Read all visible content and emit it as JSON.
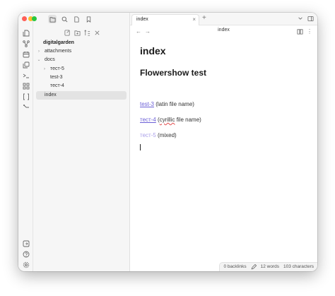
{
  "ribbon": {
    "traffic_lights": {
      "close": "#ff5f57",
      "minimize": "#febc2e",
      "maximize": "#28c840"
    },
    "top_icons": [
      "files-icon",
      "graph-icon",
      "calendar-icon",
      "copy-icon",
      "terminal-icon",
      "blocks-icon",
      "brackets-icon",
      "git-icon"
    ],
    "bottom_icons": [
      "vault-switch-icon",
      "help-icon",
      "settings-icon"
    ]
  },
  "sidebar": {
    "toolbar": [
      "file-explorer-icon",
      "search-icon",
      "bookmark-file-icon",
      "bookmark-icon"
    ],
    "actions": [
      "new-note-icon",
      "new-folder-icon",
      "sort-icon",
      "collapse-icon"
    ],
    "root": "digitalgarden",
    "items": [
      {
        "label": "attachments",
        "chevron": "›"
      },
      {
        "label": "docs",
        "chevron": "⌄"
      },
      {
        "label": "тест-5",
        "chevron": "›"
      },
      {
        "label": "test-3",
        "chevron": ""
      },
      {
        "label": "тест-4",
        "chevron": ""
      },
      {
        "label": "index",
        "chevron": ""
      }
    ]
  },
  "tabs": [
    {
      "label": "index",
      "close": "×"
    }
  ],
  "tab_new": "+",
  "nav": {
    "back": "←",
    "forward": "→",
    "title": "index",
    "more": "⋮"
  },
  "doc": {
    "title": "index",
    "heading": "Flowershow test",
    "lines": [
      {
        "link": "test-3",
        "pre": "",
        "squiggle": "",
        "rest": " (latin file name)"
      },
      {
        "link": "тест-4",
        "pre": " (",
        "squiggle": "cyrillic",
        "rest": " file name)"
      },
      {
        "link": "тест-5",
        "pre": "",
        "squiggle": "",
        "rest": " (mixed)"
      }
    ]
  },
  "status": {
    "backlinks": "0 backlinks",
    "words": "12 words",
    "characters": "103 characters"
  },
  "colors": {
    "accent": "#6b5fd6",
    "sidebar_bg": "#f6f6f6",
    "active_row": "#e3e3e3"
  }
}
